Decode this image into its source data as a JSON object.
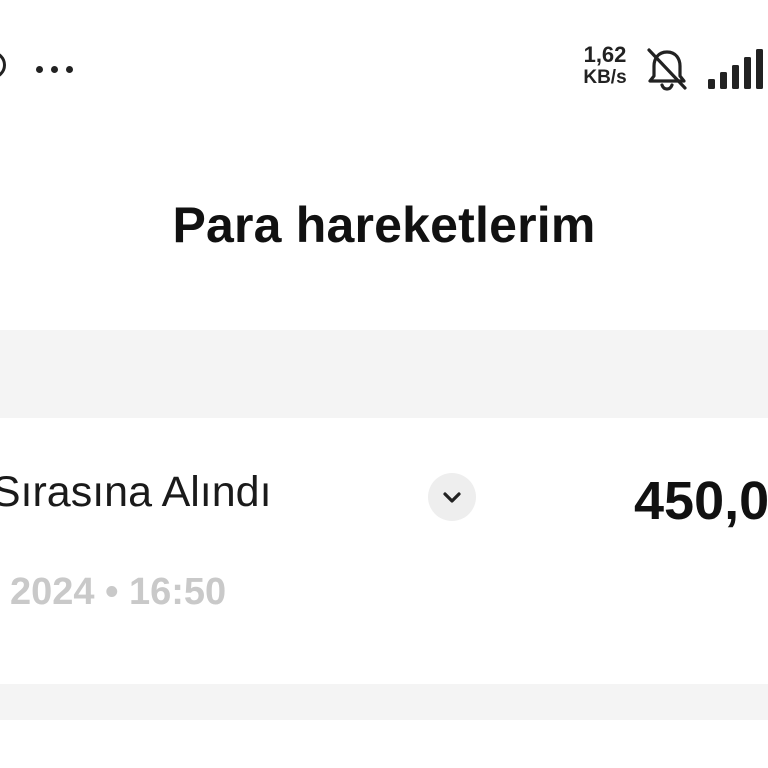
{
  "status_bar": {
    "network_speed_value": "1,62",
    "network_speed_unit": "KB/s",
    "icons": [
      "clock-icon",
      "more-dots-icon",
      "bell-muted-icon",
      "signal-icon"
    ]
  },
  "header": {
    "title": "Para hareketlerim"
  },
  "transactions": [
    {
      "status": "e Sırasına Alındı",
      "amount": "450,0",
      "datetime": "2024 • 16:50",
      "expand_icon": "chevron-down-icon"
    }
  ],
  "colors": {
    "background": "#ffffff",
    "band": "#f4f4f4",
    "text_primary": "#111111",
    "text_muted": "#c9c9c9",
    "chip_bg": "#eeeeee"
  }
}
